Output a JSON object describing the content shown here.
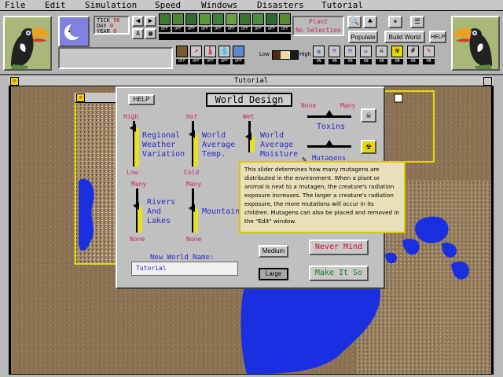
{
  "menu": [
    "File",
    "Edit",
    "Simulation",
    "Speed",
    "Windows",
    "Disasters",
    "Tutorial"
  ],
  "status": {
    "tick_label": "TICK",
    "tick_value": "56",
    "day_label": "DAY",
    "day_value": "0",
    "year_label": "YEAR",
    "year_value": "0"
  },
  "plant": {
    "title": "Plant",
    "selection": "No Selection"
  },
  "buttons": {
    "populate": "Populate",
    "build_world": "Build World",
    "help": "HELP",
    "a": "A"
  },
  "switch": {
    "off": "OFF",
    "on": "ON"
  },
  "temp_scale": {
    "low": "Low",
    "high": "High"
  },
  "tutorial_window": {
    "title": "Tutorial"
  },
  "dialog": {
    "help": "HELP",
    "title": "World Design",
    "regional": {
      "top": "High",
      "bottom": "Low",
      "label": [
        "Regional",
        "Weather",
        "Variation"
      ],
      "level": 0.15
    },
    "temp": {
      "top": "Hot",
      "bottom": "Cold",
      "label": [
        "World",
        "Average",
        "Temp."
      ],
      "level": 0.3
    },
    "moisture": {
      "top": "Wet",
      "label": [
        "World",
        "Average",
        "Moisture"
      ],
      "level": 0.5
    },
    "rivers": {
      "top": "Many",
      "bottom": "None",
      "label": [
        "Rivers",
        "And",
        "Lakes"
      ],
      "level": 0.4
    },
    "mountains": {
      "top": "Many",
      "bottom": "None",
      "label": "Mountain",
      "level": 0.45
    },
    "toxins": {
      "none": "None",
      "many": "Many",
      "label": "Toxins",
      "level": 0.5
    },
    "mutagens": {
      "label": "Mutagens",
      "level": 0.5
    },
    "new_world_label": "New World Name:",
    "new_world_value": "Tutorial",
    "size_medium": "Medium",
    "size_large": "Large",
    "never_mind": "Never Mind",
    "make_it_so": "Make It So"
  },
  "tooltip": "This slider determines how many mutagens are distributed in the environment. When a plant or animal is next to a mutagen, the creature's radiation exposure increases. The larger a creature's radiation exposure, the more mutations will occur in its children. Mutagens can also be placed and removed in the \"Edit\" window."
}
